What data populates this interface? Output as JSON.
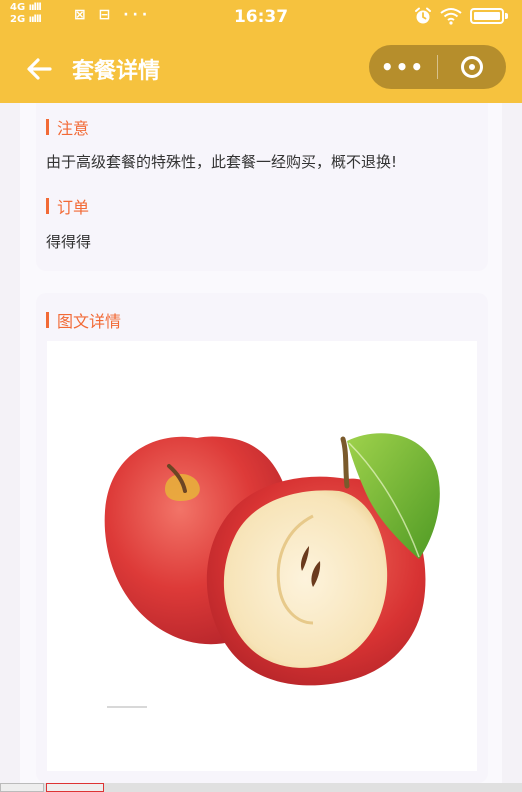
{
  "statusbar": {
    "network_top": "4G",
    "network_bottom": "2G",
    "signal": "ıılll",
    "left_icons": "⊠ ⊟ ···",
    "time": "16:37"
  },
  "nav": {
    "title": "套餐详情",
    "back_icon": "arrow-left-icon",
    "more_icon": "more-dots-icon",
    "close_icon": "target-circle-icon",
    "more_label": "•••"
  },
  "notice": {
    "title": "注意",
    "text": "由于高级套餐的特殊性，此套餐一经购买，概不退换!"
  },
  "order": {
    "title": "订单",
    "text": "得得得"
  },
  "detail": {
    "title": "图文详情",
    "image_subject": "apple-photo"
  },
  "colors": {
    "header": "#f6c23e",
    "accent": "#f26a36",
    "background": "#f4f2f7"
  }
}
